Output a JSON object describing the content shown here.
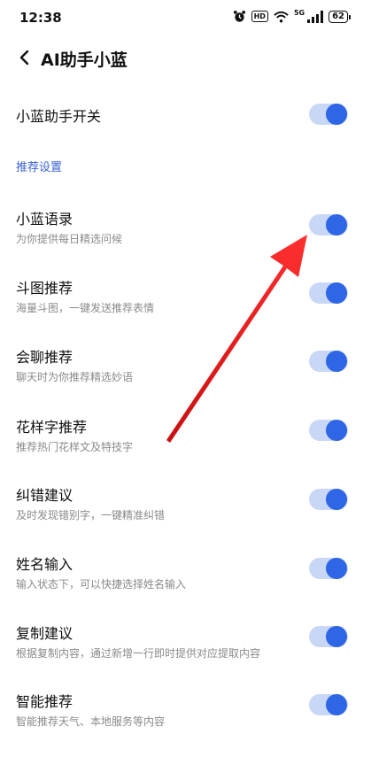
{
  "status_bar": {
    "time": "12:38",
    "hd_label": "HD",
    "network_label": "5G",
    "battery": "62"
  },
  "header": {
    "title": "AI助手小蓝"
  },
  "main_toggle": {
    "label": "小蓝助手开关",
    "on": true
  },
  "section": {
    "title": "推荐设置"
  },
  "settings": [
    {
      "title": "小蓝语录",
      "subtitle": "为你提供每日精选问候",
      "on": true
    },
    {
      "title": "斗图推荐",
      "subtitle": "海量斗图，一键发送推荐表情",
      "on": true
    },
    {
      "title": "会聊推荐",
      "subtitle": "聊天时为你推荐精选妙语",
      "on": true
    },
    {
      "title": "花样字推荐",
      "subtitle": "推荐热门花样文及特技字",
      "on": true
    },
    {
      "title": "纠错建议",
      "subtitle": "及时发现错别字，一键精准纠错",
      "on": true
    },
    {
      "title": "姓名输入",
      "subtitle": "输入状态下，可以快捷选择姓名输入",
      "on": true
    },
    {
      "title": "复制建议",
      "subtitle": "根据复制内容，通过新增一行即时提供对应提取内容",
      "on": true
    },
    {
      "title": "智能推荐",
      "subtitle": "智能推荐天气、本地服务等内容",
      "on": true
    }
  ],
  "colors": {
    "accent": "#2f66e6",
    "track": "#c9d7f6",
    "annotation_arrow": "#e01b1b"
  }
}
